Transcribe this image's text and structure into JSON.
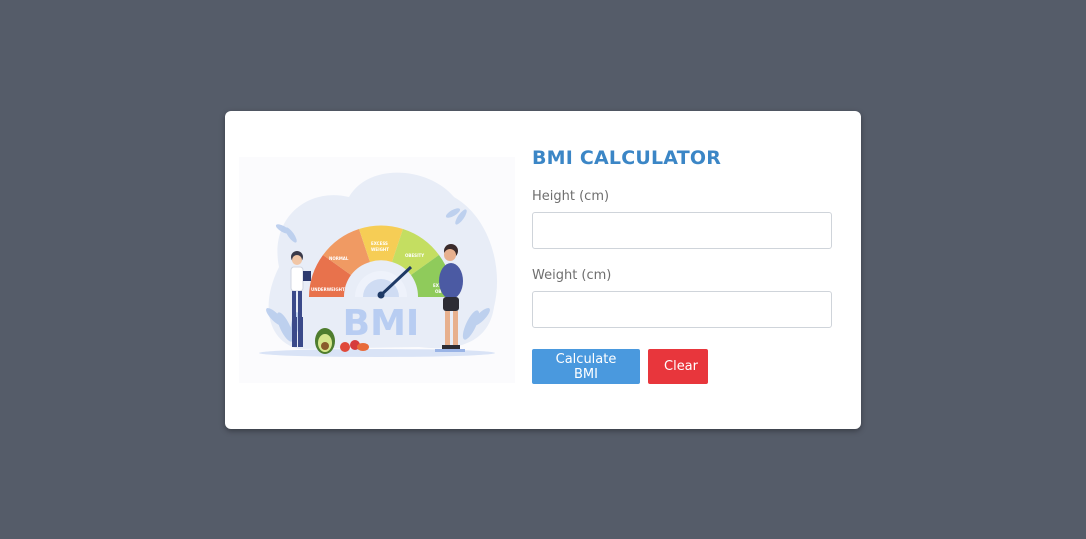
{
  "form": {
    "title": "BMI CALCULATOR",
    "height_label": "Height (cm)",
    "height_value": "",
    "weight_label": "Weight (cm)",
    "weight_value": "",
    "calculate_label": "Calculate BMI",
    "clear_label": "Clear"
  },
  "illustration": {
    "center_text": "BMI",
    "gauge_labels": [
      "UNDERWEIGHT",
      "NORMAL",
      "EXCESS WEIGHT",
      "OBESITY",
      "EXTREME OBES"
    ],
    "icon": "bmi-scale-illustration"
  },
  "colors": {
    "background": "#555c69",
    "title": "#3b86c6",
    "calculate_button": "#4a99de",
    "clear_button": "#e8363c"
  }
}
